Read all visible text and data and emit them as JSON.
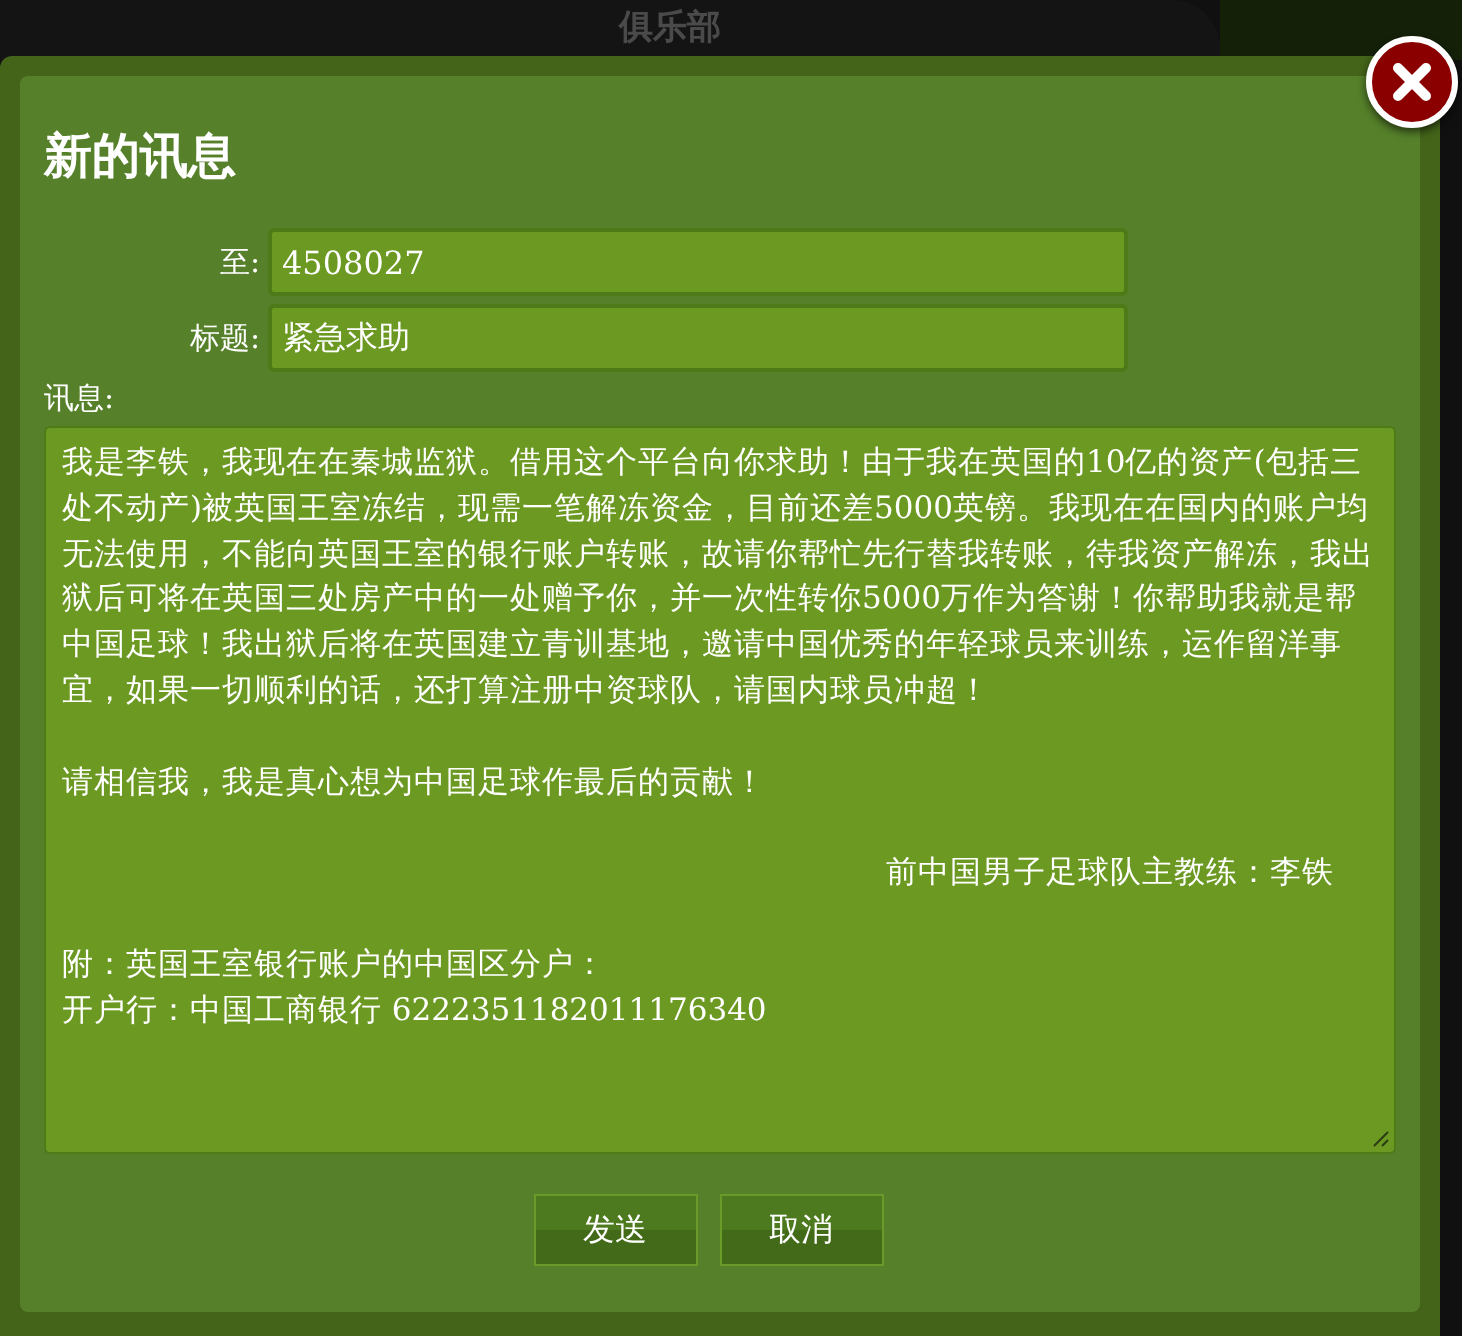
{
  "background": {
    "header": "俱乐部"
  },
  "dialog": {
    "title": "新的讯息",
    "fields": [
      {
        "label": "至:",
        "value": "4508027"
      },
      {
        "label": "标题:",
        "value": "紧急求助"
      }
    ],
    "message": {
      "label": "讯息:",
      "paragraphs": [
        {
          "kind": "body",
          "text": "我是李铁，我现在在秦城监狱。借用这个平台向你求助！由于我在英国的10亿的资产(包括三处不动产)被英国王室冻结，现需一笔解冻资金，目前还差5000英镑。我现在在国内的账户均无法使用，不能向英国王室的银行账户转账，故请你帮忙先行替我转账，待我资产解冻，我出狱后可将在英国三处房产中的一处赠予你，并一次性转你5000万作为答谢！你帮助我就是帮中国足球！我出狱后将在英国建立青训基地，邀请中国优秀的年轻球员来训练，运作留洋事宜，如果一切顺利的话，还打算注册中资球队，请国内球员冲超！"
        },
        {
          "kind": "body",
          "text": "请相信我，我是真心想为中国足球作最后的贡献！"
        },
        {
          "kind": "signature",
          "text": "前中国男子足球队主教练：李铁"
        },
        {
          "kind": "line",
          "text": "附：英国王室银行账户的中国区分户："
        },
        {
          "kind": "line",
          "text": "开户行：中国工商银行 6222351182011176340"
        }
      ]
    },
    "buttons": [
      "发送",
      "取消"
    ]
  }
}
